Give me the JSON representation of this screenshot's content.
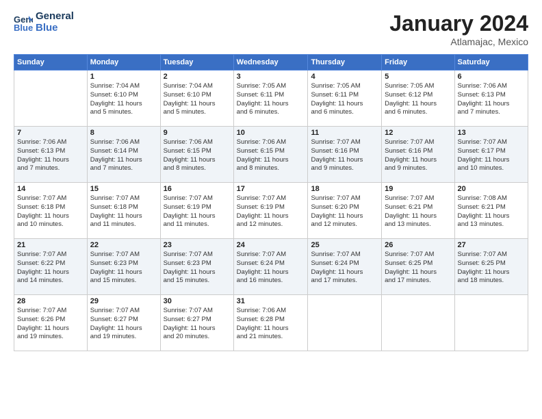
{
  "logo": {
    "line1": "General",
    "line2": "Blue"
  },
  "title": "January 2024",
  "subtitle": "Atlamajac, Mexico",
  "weekdays": [
    "Sunday",
    "Monday",
    "Tuesday",
    "Wednesday",
    "Thursday",
    "Friday",
    "Saturday"
  ],
  "weeks": [
    [
      {
        "day": "",
        "info": ""
      },
      {
        "day": "1",
        "info": "Sunrise: 7:04 AM\nSunset: 6:10 PM\nDaylight: 11 hours\nand 5 minutes."
      },
      {
        "day": "2",
        "info": "Sunrise: 7:04 AM\nSunset: 6:10 PM\nDaylight: 11 hours\nand 5 minutes."
      },
      {
        "day": "3",
        "info": "Sunrise: 7:05 AM\nSunset: 6:11 PM\nDaylight: 11 hours\nand 6 minutes."
      },
      {
        "day": "4",
        "info": "Sunrise: 7:05 AM\nSunset: 6:11 PM\nDaylight: 11 hours\nand 6 minutes."
      },
      {
        "day": "5",
        "info": "Sunrise: 7:05 AM\nSunset: 6:12 PM\nDaylight: 11 hours\nand 6 minutes."
      },
      {
        "day": "6",
        "info": "Sunrise: 7:06 AM\nSunset: 6:13 PM\nDaylight: 11 hours\nand 7 minutes."
      }
    ],
    [
      {
        "day": "7",
        "info": "Sunrise: 7:06 AM\nSunset: 6:13 PM\nDaylight: 11 hours\nand 7 minutes."
      },
      {
        "day": "8",
        "info": "Sunrise: 7:06 AM\nSunset: 6:14 PM\nDaylight: 11 hours\nand 7 minutes."
      },
      {
        "day": "9",
        "info": "Sunrise: 7:06 AM\nSunset: 6:15 PM\nDaylight: 11 hours\nand 8 minutes."
      },
      {
        "day": "10",
        "info": "Sunrise: 7:06 AM\nSunset: 6:15 PM\nDaylight: 11 hours\nand 8 minutes."
      },
      {
        "day": "11",
        "info": "Sunrise: 7:07 AM\nSunset: 6:16 PM\nDaylight: 11 hours\nand 9 minutes."
      },
      {
        "day": "12",
        "info": "Sunrise: 7:07 AM\nSunset: 6:16 PM\nDaylight: 11 hours\nand 9 minutes."
      },
      {
        "day": "13",
        "info": "Sunrise: 7:07 AM\nSunset: 6:17 PM\nDaylight: 11 hours\nand 10 minutes."
      }
    ],
    [
      {
        "day": "14",
        "info": "Sunrise: 7:07 AM\nSunset: 6:18 PM\nDaylight: 11 hours\nand 10 minutes."
      },
      {
        "day": "15",
        "info": "Sunrise: 7:07 AM\nSunset: 6:18 PM\nDaylight: 11 hours\nand 11 minutes."
      },
      {
        "day": "16",
        "info": "Sunrise: 7:07 AM\nSunset: 6:19 PM\nDaylight: 11 hours\nand 11 minutes."
      },
      {
        "day": "17",
        "info": "Sunrise: 7:07 AM\nSunset: 6:19 PM\nDaylight: 11 hours\nand 12 minutes."
      },
      {
        "day": "18",
        "info": "Sunrise: 7:07 AM\nSunset: 6:20 PM\nDaylight: 11 hours\nand 12 minutes."
      },
      {
        "day": "19",
        "info": "Sunrise: 7:07 AM\nSunset: 6:21 PM\nDaylight: 11 hours\nand 13 minutes."
      },
      {
        "day": "20",
        "info": "Sunrise: 7:08 AM\nSunset: 6:21 PM\nDaylight: 11 hours\nand 13 minutes."
      }
    ],
    [
      {
        "day": "21",
        "info": "Sunrise: 7:07 AM\nSunset: 6:22 PM\nDaylight: 11 hours\nand 14 minutes."
      },
      {
        "day": "22",
        "info": "Sunrise: 7:07 AM\nSunset: 6:23 PM\nDaylight: 11 hours\nand 15 minutes."
      },
      {
        "day": "23",
        "info": "Sunrise: 7:07 AM\nSunset: 6:23 PM\nDaylight: 11 hours\nand 15 minutes."
      },
      {
        "day": "24",
        "info": "Sunrise: 7:07 AM\nSunset: 6:24 PM\nDaylight: 11 hours\nand 16 minutes."
      },
      {
        "day": "25",
        "info": "Sunrise: 7:07 AM\nSunset: 6:24 PM\nDaylight: 11 hours\nand 17 minutes."
      },
      {
        "day": "26",
        "info": "Sunrise: 7:07 AM\nSunset: 6:25 PM\nDaylight: 11 hours\nand 17 minutes."
      },
      {
        "day": "27",
        "info": "Sunrise: 7:07 AM\nSunset: 6:25 PM\nDaylight: 11 hours\nand 18 minutes."
      }
    ],
    [
      {
        "day": "28",
        "info": "Sunrise: 7:07 AM\nSunset: 6:26 PM\nDaylight: 11 hours\nand 19 minutes."
      },
      {
        "day": "29",
        "info": "Sunrise: 7:07 AM\nSunset: 6:27 PM\nDaylight: 11 hours\nand 19 minutes."
      },
      {
        "day": "30",
        "info": "Sunrise: 7:07 AM\nSunset: 6:27 PM\nDaylight: 11 hours\nand 20 minutes."
      },
      {
        "day": "31",
        "info": "Sunrise: 7:06 AM\nSunset: 6:28 PM\nDaylight: 11 hours\nand 21 minutes."
      },
      {
        "day": "",
        "info": ""
      },
      {
        "day": "",
        "info": ""
      },
      {
        "day": "",
        "info": ""
      }
    ]
  ]
}
